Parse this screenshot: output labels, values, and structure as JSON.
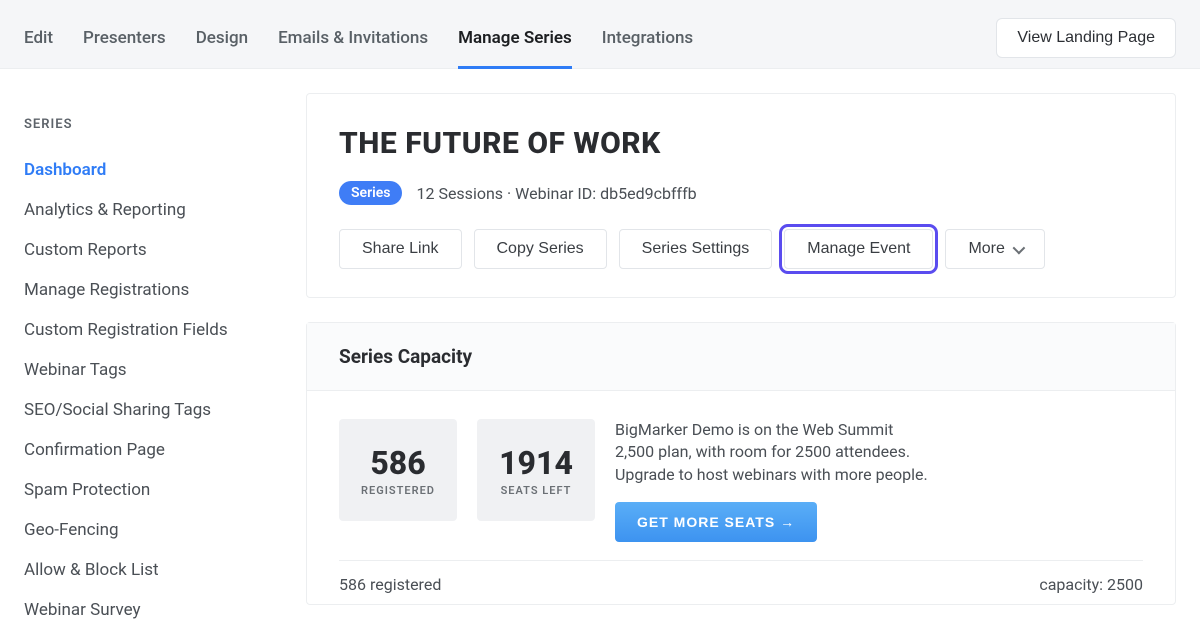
{
  "topnav": {
    "tabs": [
      "Edit",
      "Presenters",
      "Design",
      "Emails & Invitations",
      "Manage Series",
      "Integrations"
    ],
    "active_index": 4,
    "view_landing": "View Landing Page"
  },
  "sidebar": {
    "label": "SERIES",
    "items": [
      "Dashboard",
      "Analytics & Reporting",
      "Custom Reports",
      "Manage Registrations",
      "Custom Registration Fields",
      "Webinar Tags",
      "SEO/Social Sharing Tags",
      "Confirmation Page",
      "Spam Protection",
      "Geo-Fencing",
      "Allow & Block List",
      "Webinar Survey"
    ],
    "active_index": 0
  },
  "series": {
    "title": "THE FUTURE OF WORK",
    "badge": "Series",
    "meta": "12 Sessions · Webinar ID: db5ed9cbfffb",
    "actions": {
      "share": "Share Link",
      "copy": "Copy Series",
      "settings": "Series Settings",
      "manage_event": "Manage Event",
      "more": "More"
    }
  },
  "capacity": {
    "header": "Series Capacity",
    "registered": {
      "value": "586",
      "label": "REGISTERED"
    },
    "seats_left": {
      "value": "1914",
      "label": "SEATS LEFT"
    },
    "description": "BigMarker Demo is on the Web Summit 2,500 plan, with room for 2500 attendees. Upgrade to host webinars with more people.",
    "cta": "GET MORE SEATS →",
    "footer_left": "586 registered",
    "footer_right": "capacity: 2500"
  }
}
